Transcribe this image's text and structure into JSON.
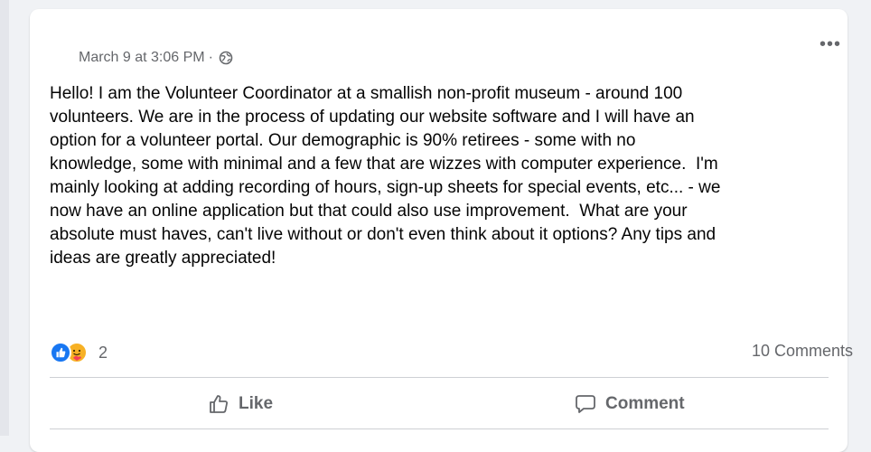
{
  "post": {
    "timestamp": "March 9 at 3:06 PM",
    "separator": "·",
    "audience_icon": "globe-icon",
    "more_icon": "ellipsis-icon",
    "text": "Hello! I am the Volunteer Coordinator at a smallish non-profit museum - around 100\nvolunteers. We are in the process of updating our website software and I will have an\noption for a volunteer portal. Our demographic is 90% retirees - some with no\nknowledge, some with minimal and a few that are wizzes with computer experience.  I'm\nmainly looking at adding recording of hours, sign-up sheets for special events, etc... - we\nnow have an online application but that could also use improvement.  What are your\nabsolute must haves, can't live without or don't even think about it options? Any tips and\nideas are greatly appreciated!"
  },
  "reactions": {
    "icons": [
      "like-reaction-icon",
      "care-reaction-icon"
    ],
    "count": "2",
    "comments_label": "10 Comments"
  },
  "actions": {
    "like_label": "Like",
    "comment_label": "Comment"
  },
  "colors": {
    "secondary_text": "#65676b",
    "like_blue": "#1877f2",
    "care_yellow": "#f7b125",
    "divider": "#ced0d4"
  }
}
